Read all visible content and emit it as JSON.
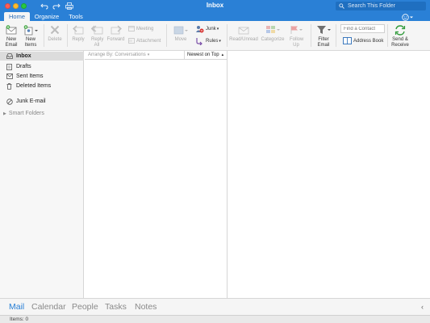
{
  "window": {
    "title": "Inbox"
  },
  "search": {
    "placeholder": "Search This Folder"
  },
  "tabs": [
    {
      "label": "Home",
      "active": true
    },
    {
      "label": "Organize",
      "active": false
    },
    {
      "label": "Tools",
      "active": false
    }
  ],
  "ribbon": {
    "new_email": "New Email",
    "new_items": "New Items",
    "delete": "Delete",
    "reply": "Reply",
    "reply_all": "Reply All",
    "forward": "Forward",
    "meeting": "Meeting",
    "attachment": "Attachment",
    "move": "Move",
    "junk": "Junk",
    "rules": "Rules",
    "read_unread": "Read/Unread",
    "categorize": "Categorize",
    "follow_up": "Follow Up",
    "filter_email": "Filter Email",
    "find_contact_placeholder": "Find a Contact",
    "address_book": "Address Book",
    "send_receive": "Send & Receive"
  },
  "folders": [
    {
      "label": "Inbox",
      "icon": "inbox-icon",
      "selected": true
    },
    {
      "label": "Drafts",
      "icon": "drafts-icon",
      "selected": false
    },
    {
      "label": "Sent Items",
      "icon": "sent-items-icon",
      "selected": false
    },
    {
      "label": "Deleted Items",
      "icon": "trash-icon",
      "selected": false
    },
    {
      "label": "Junk E-mail",
      "icon": "junk-icon",
      "selected": false
    }
  ],
  "smart_folders": "Smart Folders",
  "message_list": {
    "arrange_by": "Arrange By: Conversations",
    "sort_order": "Newest on Top"
  },
  "nav": [
    {
      "label": "Mail",
      "active": true
    },
    {
      "label": "Calendar",
      "active": false
    },
    {
      "label": "People",
      "active": false
    },
    {
      "label": "Tasks",
      "active": false
    },
    {
      "label": "Notes",
      "active": false
    }
  ],
  "status": {
    "items": "Items: 0"
  },
  "colors": {
    "accent": "#2a80d6",
    "disabled_text": "#a9a9a9"
  }
}
